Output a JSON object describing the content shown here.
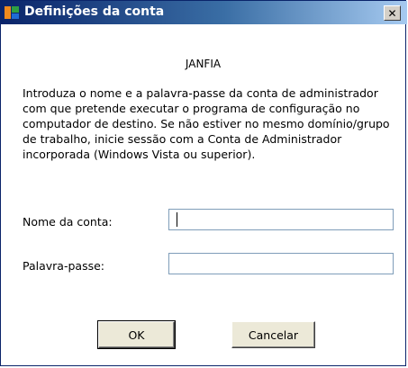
{
  "window": {
    "title": "Definições da conta",
    "close_glyph": "✕"
  },
  "dialog": {
    "computer_name": "JANFIA",
    "description": "Introduza o nome e a palavra-passe da conta de administrador com que pretende executar o programa de configuração no computador de destino. Se não estiver no mesmo domínio/grupo de trabalho, inicie sessão com a Conta de Administrador incorporada (Windows Vista ou superior).",
    "account_label": "Nome da conta:",
    "account_value": "",
    "password_label": "Palavra-passe:",
    "password_value": ""
  },
  "buttons": {
    "ok_label": "OK",
    "cancel_label": "Cancelar"
  },
  "colors": {
    "titlebar_start": "#0a246a",
    "titlebar_end": "#a6caf0",
    "icon_orange": "#f08a1e",
    "icon_green": "#2ea043"
  },
  "icons": {
    "title_icon": "app-icon"
  }
}
